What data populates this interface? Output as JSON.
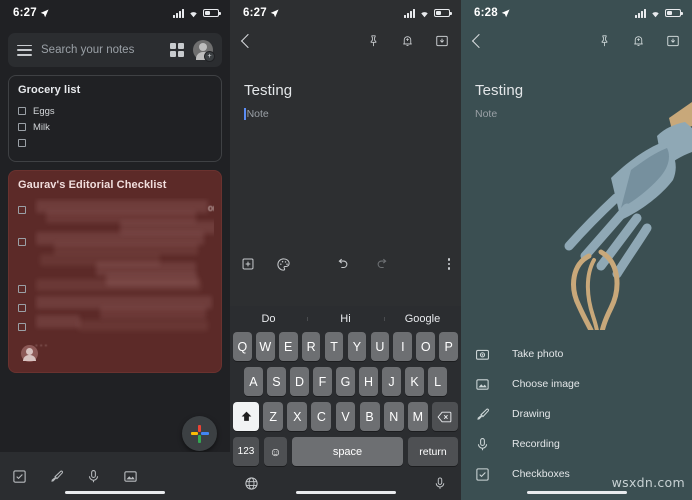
{
  "panel1": {
    "status": {
      "time": "6:27",
      "location_icon": "location-arrow-icon",
      "signal_icon": "signal-bars-icon",
      "wifi_icon": "wifi-icon",
      "battery_icon": "battery-icon"
    },
    "search": {
      "placeholder": "Search your notes",
      "menu_icon": "hamburger-menu-icon",
      "view_icon": "grid-view-icon",
      "account_icon": "account-avatar-icon"
    },
    "notes": [
      {
        "title": "Grocery list",
        "items": [
          "Eggs",
          "Milk",
          ""
        ]
      },
      {
        "title": "Gaurav's Editorial Checklist",
        "items": [
          "",
          "",
          "",
          "",
          ""
        ],
        "redacted": true,
        "overflow": "...",
        "color": "#5c2a28"
      }
    ],
    "bottom_icons": [
      "checkbox-icon",
      "brush-icon",
      "microphone-icon",
      "image-icon"
    ],
    "fab": {
      "icon": "google-plus-icon",
      "label": ""
    }
  },
  "panel2": {
    "status": {
      "time": "6:27"
    },
    "top_icons": [
      "back-arrow-icon",
      "pin-icon",
      "reminder-bell-icon",
      "archive-icon"
    ],
    "note": {
      "title": "Testing",
      "body_placeholder": "Note"
    },
    "toolbar_icons": [
      "add-box-icon",
      "palette-icon",
      "undo-icon",
      "redo-icon",
      "overflow-menu-icon"
    ],
    "keyboard": {
      "suggestions": [
        "Do",
        "Hi",
        "Google"
      ],
      "row1": [
        "Q",
        "W",
        "E",
        "R",
        "T",
        "Y",
        "U",
        "I",
        "O",
        "P"
      ],
      "row2": [
        "A",
        "S",
        "D",
        "F",
        "G",
        "H",
        "J",
        "K",
        "L"
      ],
      "row3": [
        "Z",
        "X",
        "C",
        "V",
        "B",
        "N",
        "M"
      ],
      "shift_key": "shift-icon",
      "backspace_key": "backspace-icon",
      "numbers_key": "123",
      "emoji_key": "emoji-icon",
      "space_key": "space",
      "return_key": "return",
      "globe_key": "globe-icon",
      "dictation_key": "microphone-icon"
    }
  },
  "panel3": {
    "status": {
      "time": "6:28"
    },
    "top_icons": [
      "back-arrow-icon",
      "pin-icon",
      "reminder-bell-icon",
      "archive-icon"
    ],
    "note": {
      "title": "Testing",
      "body_placeholder": "Note"
    },
    "illustration": "fork-with-pasta-illustration",
    "sheet_items": [
      {
        "icon": "camera-icon",
        "label": "Take photo"
      },
      {
        "icon": "image-icon",
        "label": "Choose image"
      },
      {
        "icon": "brush-icon",
        "label": "Drawing"
      },
      {
        "icon": "microphone-icon",
        "label": "Recording"
      },
      {
        "icon": "checkbox-icon",
        "label": "Checkboxes"
      }
    ],
    "watermark": "wsxdn.com"
  },
  "colors": {
    "dark_bg": "#202124",
    "editor_bg": "#2d2f31",
    "teal_bg": "#3b4f52",
    "red_note": "#5c2a28",
    "caret": "#5b8df5"
  }
}
